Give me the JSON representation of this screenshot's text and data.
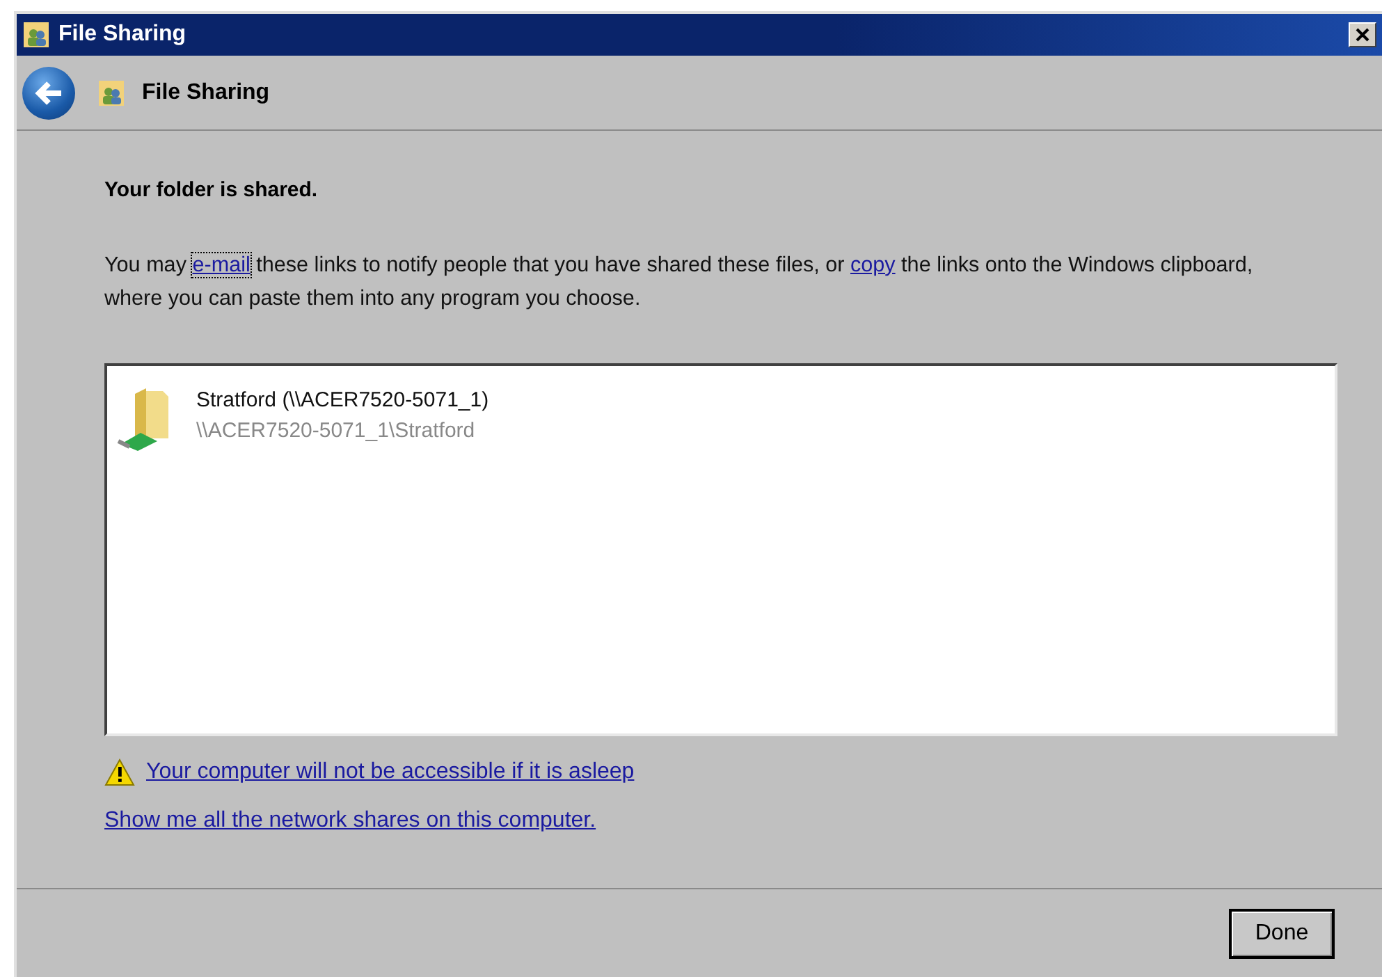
{
  "window": {
    "title": "File Sharing"
  },
  "nav": {
    "title": "File Sharing"
  },
  "heading": "Your folder is shared.",
  "paragraph": [
    {
      "kind": "text",
      "text": "You may "
    },
    {
      "kind": "link",
      "text": "e-mail",
      "focused": true
    },
    {
      "kind": "text",
      "text": " these links to notify people that you have shared these files, or "
    },
    {
      "kind": "link",
      "text": "copy",
      "focused": false
    },
    {
      "kind": "text",
      "text": " the links onto the Windows clipboard, where you can paste them into any program you choose."
    }
  ],
  "shares": [
    {
      "name": "Stratford (\\\\ACER7520-5071_1)",
      "path": "\\\\ACER7520-5071_1\\Stratford"
    }
  ],
  "links": [
    {
      "kind": "warning",
      "text": "Your computer will not be accessible if it is asleep"
    },
    {
      "kind": "plain",
      "text": "Show me all the network shares on this computer."
    }
  ],
  "buttons": [
    {
      "label": "Done",
      "default": true
    }
  ]
}
